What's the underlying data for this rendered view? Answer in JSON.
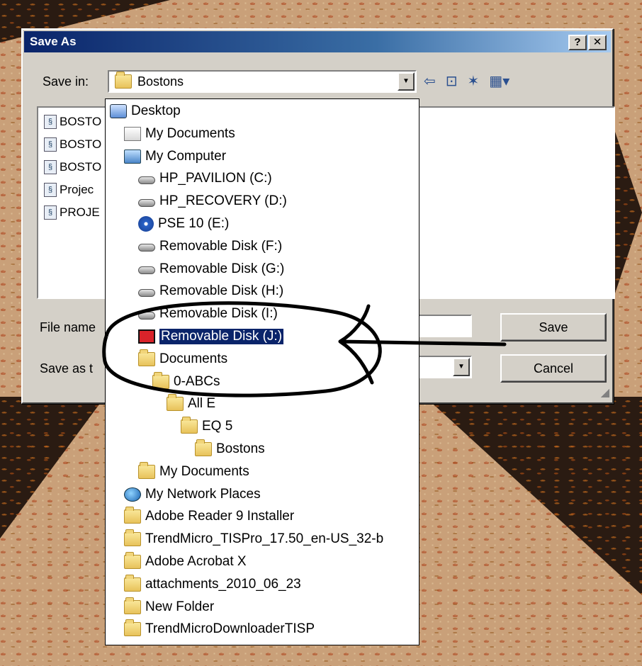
{
  "dialog": {
    "title": "Save As",
    "help_btn": "?",
    "close_btn": "✕",
    "save_in_label": "Save in:",
    "save_in_value": "Bostons",
    "file_name_label": "File name",
    "save_as_type_label": "Save as t",
    "save_button": "Save",
    "cancel_button": "Cancel"
  },
  "toolbar_icons": [
    "back-icon",
    "up-folder-icon",
    "new-folder-icon",
    "views-menu-icon"
  ],
  "files": [
    {
      "label": "BOSTO"
    },
    {
      "label": "BOSTO"
    },
    {
      "label": "BOSTO"
    },
    {
      "label": "Projec"
    },
    {
      "label": "PROJE"
    }
  ],
  "dropdown": {
    "items": [
      {
        "label": "Desktop",
        "icon": "desktop-icon",
        "indent": 0
      },
      {
        "label": "My Documents",
        "icon": "my-documents-icon",
        "indent": 1
      },
      {
        "label": "My Computer",
        "icon": "my-computer-icon",
        "indent": 1
      },
      {
        "label": "HP_PAVILION (C:)",
        "icon": "hard-drive-icon",
        "indent": 2
      },
      {
        "label": "HP_RECOVERY (D:)",
        "icon": "hard-drive-icon",
        "indent": 2
      },
      {
        "label": "PSE 10 (E:)",
        "icon": "cd-drive-icon",
        "indent": 2
      },
      {
        "label": "Removable Disk (F:)",
        "icon": "removable-disk-icon",
        "indent": 2
      },
      {
        "label": "Removable Disk (G:)",
        "icon": "removable-disk-icon",
        "indent": 2
      },
      {
        "label": "Removable Disk (H:)",
        "icon": "removable-disk-icon",
        "indent": 2
      },
      {
        "label": "Removable Disk (I:)",
        "icon": "removable-disk-icon",
        "indent": 2
      },
      {
        "label": "Removable Disk (J:)",
        "icon": "usb-disk-icon",
        "indent": 2,
        "selected": true
      },
      {
        "label": "Documents",
        "icon": "folder-icon",
        "indent": 2
      },
      {
        "label": "0-ABCs",
        "icon": "folder-icon",
        "indent": 3
      },
      {
        "label": "All E",
        "icon": "folder-icon",
        "indent": 4
      },
      {
        "label": "EQ 5",
        "icon": "folder-icon",
        "indent": 5
      },
      {
        "label": "Bostons",
        "icon": "folder-icon",
        "indent": 6
      },
      {
        "label": "My Documents",
        "icon": "folder-icon",
        "indent": 2
      },
      {
        "label": "My Network Places",
        "icon": "network-places-icon",
        "indent": 1
      },
      {
        "label": "Adobe Reader 9 Installer",
        "icon": "folder-icon",
        "indent": 1
      },
      {
        "label": "TrendMicro_TISPro_17.50_en-US_32-b",
        "icon": "folder-icon",
        "indent": 1
      },
      {
        "label": "Adobe Acrobat X",
        "icon": "folder-icon",
        "indent": 1
      },
      {
        "label": "attachments_2010_06_23",
        "icon": "folder-icon",
        "indent": 1
      },
      {
        "label": "New Folder",
        "icon": "folder-icon",
        "indent": 1
      },
      {
        "label": "TrendMicroDownloaderTISP",
        "icon": "folder-icon",
        "indent": 1
      }
    ]
  },
  "colors": {
    "selection": "#0a246a",
    "dialog_face": "#d4d0c8",
    "annotation": "#000000"
  }
}
